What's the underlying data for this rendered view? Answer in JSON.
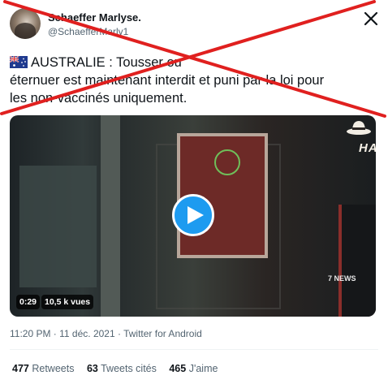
{
  "author": {
    "name": "Schaeffer Marlyse.",
    "handle": "@SchaefferMarly1"
  },
  "tweet": {
    "flag_icon": "australia-flag-icon",
    "text_line1": "AUSTRALIE : Tousser ou",
    "text_line2": "éternuer est maintenant interdit et puni par la loi pour",
    "text_line3": "les non-vaccinés uniquement."
  },
  "video": {
    "duration": "0:29",
    "views": "10,5 k vues",
    "sign_text": "HATS",
    "watermark": "7 NEWS",
    "play_icon": "play-icon"
  },
  "meta": {
    "timestamp": "11:20 PM · 11 déc. 2021 · Twitter for Android"
  },
  "stats": {
    "retweets_count": "477",
    "retweets_label": "Retweets",
    "quotes_count": "63",
    "quotes_label": "Tweets cités",
    "likes_count": "465",
    "likes_label": "J'aime"
  },
  "overlay": {
    "cross_color": "#e0201f"
  },
  "colors": {
    "accent": "#1d9bf0",
    "text_primary": "#0f1419",
    "text_secondary": "#536471"
  }
}
